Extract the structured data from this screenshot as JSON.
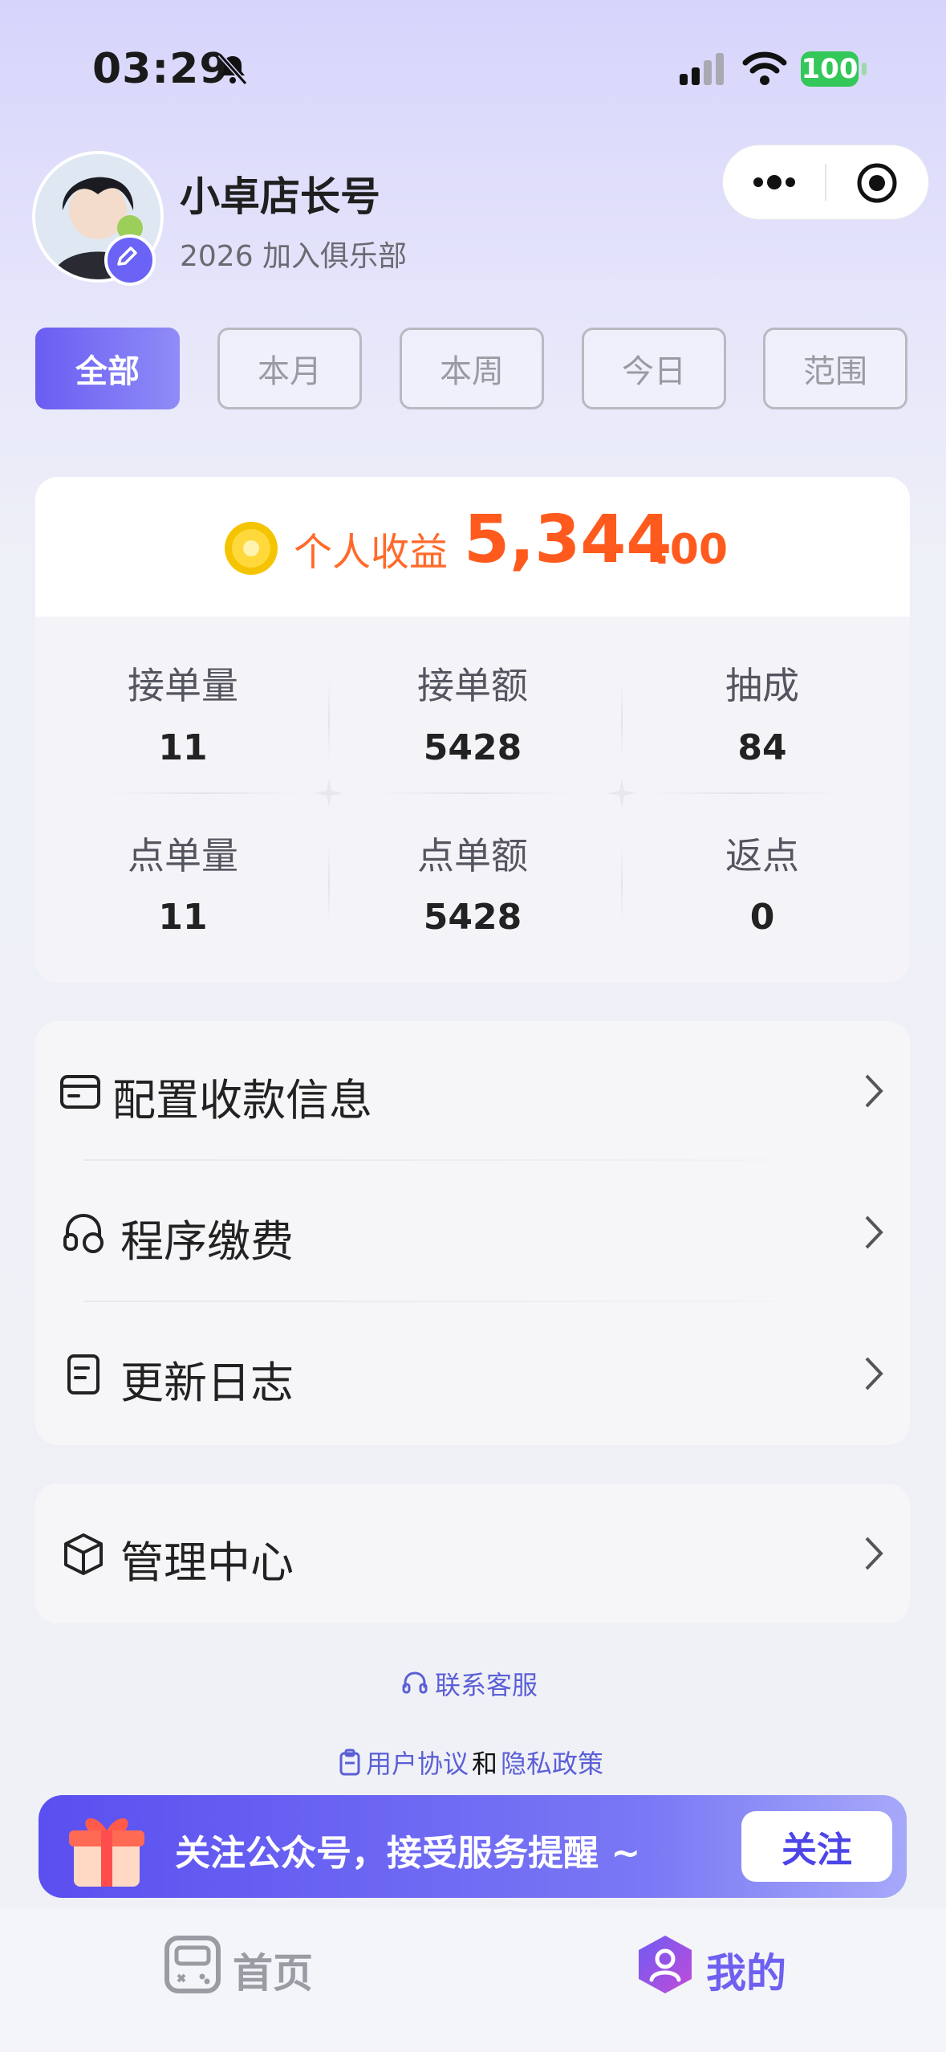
{
  "status_bar": {
    "time": "03:29",
    "battery": "100"
  },
  "profile": {
    "name": "小卓店长号",
    "joined": "2026 加入俱乐部"
  },
  "filters": {
    "tabs": [
      "全部",
      "本月",
      "本周",
      "今日",
      "范围"
    ],
    "active_index": 0
  },
  "earnings": {
    "label": "个人收益",
    "amount_int": "5,344",
    "amount_dec": ".00",
    "stats": [
      {
        "label": "接单量",
        "value": "11"
      },
      {
        "label": "接单额",
        "value": "5428"
      },
      {
        "label": "抽成",
        "value": "84"
      },
      {
        "label": "点单量",
        "value": "11"
      },
      {
        "label": "点单额",
        "value": "5428"
      },
      {
        "label": "返点",
        "value": "0"
      }
    ]
  },
  "menu": {
    "items": [
      {
        "label": "配置收款信息",
        "icon": "wallet-icon"
      },
      {
        "label": "程序缴费",
        "icon": "headset-coin-icon"
      },
      {
        "label": "更新日志",
        "icon": "document-icon"
      }
    ],
    "admin": {
      "label": "管理中心",
      "icon": "cube-icon"
    }
  },
  "links": {
    "support": "联系客服",
    "agreement": "用户协议",
    "and": "和",
    "privacy": "隐私政策"
  },
  "banner": {
    "text": "关注公众号，接受服务提醒 ~",
    "button": "关注"
  },
  "bottom_nav": {
    "home": "首页",
    "mine": "我的"
  },
  "colors": {
    "accent": "#6a5df2",
    "earnings": "#ff5a1e",
    "link": "#5b5fd6"
  }
}
